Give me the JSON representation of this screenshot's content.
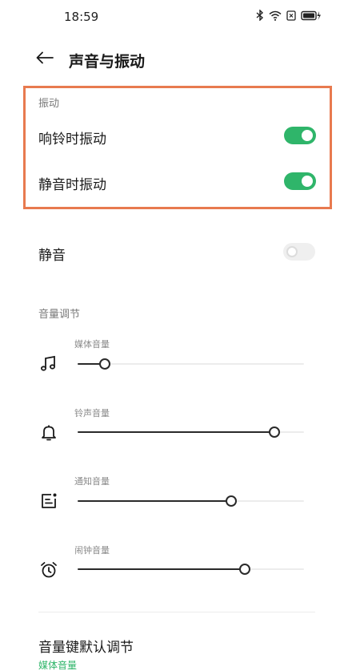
{
  "status_bar": {
    "time": "18:59",
    "icons": [
      "bluetooth-icon",
      "wifi-icon",
      "sim-icon",
      "battery-icon"
    ]
  },
  "header": {
    "title": "声音与振动",
    "back_icon": "arrow-left-icon"
  },
  "vibration": {
    "caption": "振动",
    "items": [
      {
        "label": "响铃时振动",
        "enabled": true
      },
      {
        "label": "静音时振动",
        "enabled": true
      }
    ]
  },
  "mute": {
    "label": "静音",
    "enabled": false
  },
  "volume": {
    "caption": "音量调节",
    "sliders": [
      {
        "label": "媒体音量",
        "icon": "music-note-icon",
        "level": 0.12
      },
      {
        "label": "铃声音量",
        "icon": "bell-icon",
        "level": 0.87
      },
      {
        "label": "通知音量",
        "icon": "notification-icon",
        "level": 0.68
      },
      {
        "label": "闹钟音量",
        "icon": "alarm-clock-icon",
        "level": 0.74
      }
    ]
  },
  "volume_key_default": {
    "label": "音量键默认调节",
    "value": "媒体音量"
  },
  "colors": {
    "accent": "#2fb56a",
    "highlight_border": "#e87a4f"
  }
}
